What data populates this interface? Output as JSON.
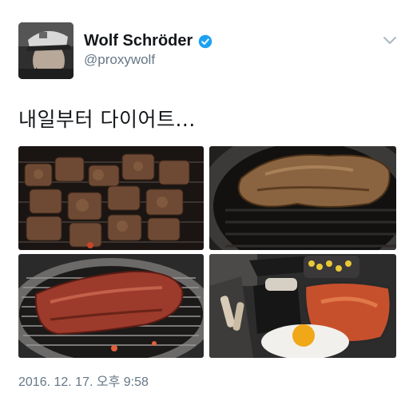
{
  "tweet": {
    "author": {
      "display_name": "Wolf Schröder",
      "handle": "@proxywolf"
    },
    "text": "내일부터 다이어트...",
    "timestamp": "2016. 12. 17. 오후 9:58",
    "photos": [
      {
        "subject": "grilled pork cubes on grill"
      },
      {
        "subject": "grilled pork slab on grill"
      },
      {
        "subject": "raw steak on round grill"
      },
      {
        "subject": "side dishes tray with fried egg, kimchi stew and corn"
      }
    ]
  },
  "colors": {
    "text_primary": "#14171a",
    "text_secondary": "#657786",
    "verified_blue": "#1da1f2"
  },
  "icons": {
    "verified": "verified-badge-icon",
    "menu": "chevron-down-icon"
  }
}
